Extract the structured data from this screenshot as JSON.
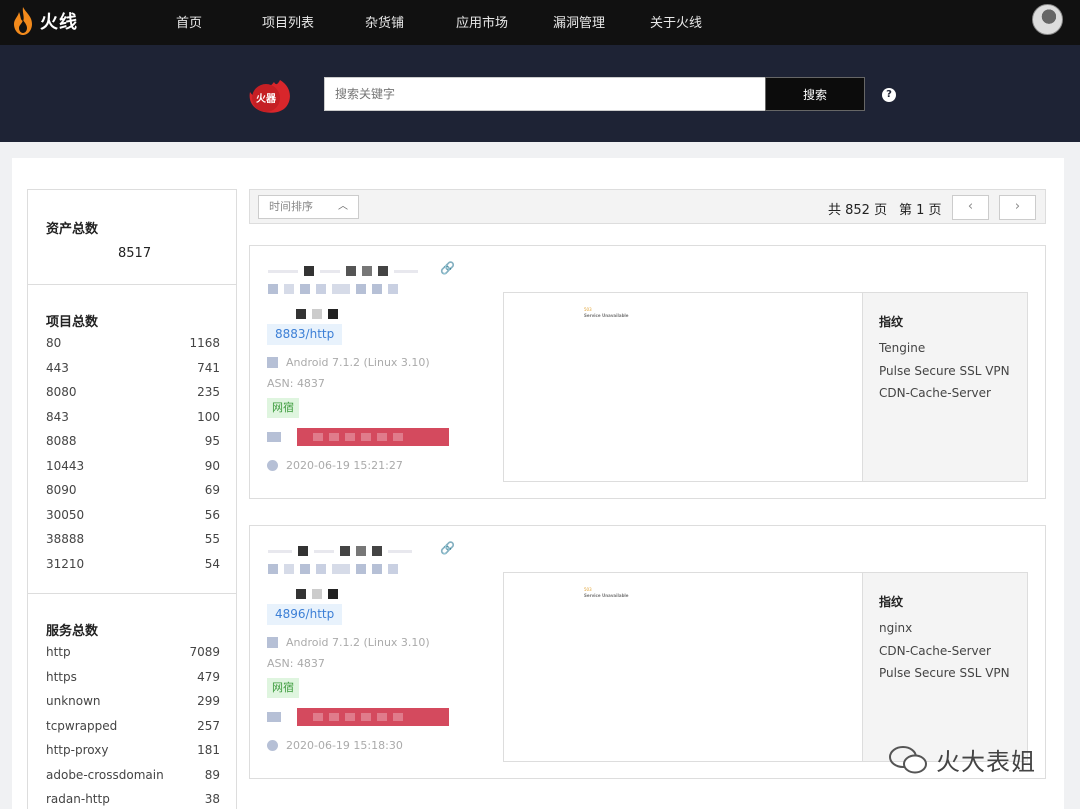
{
  "nav": {
    "brand": "火线",
    "items": [
      "首页",
      "项目列表",
      "杂货铺",
      "应用市场",
      "漏洞管理",
      "关于火线"
    ]
  },
  "search": {
    "logo_text": "火器",
    "placeholder": "搜索关键字",
    "button": "搜索",
    "help": "?"
  },
  "sidebar": {
    "assets": {
      "title": "资产总数",
      "total": "8517"
    },
    "projects": {
      "title": "项目总数",
      "rows": [
        {
          "k": "80",
          "v": "1168"
        },
        {
          "k": "443",
          "v": "741"
        },
        {
          "k": "8080",
          "v": "235"
        },
        {
          "k": "843",
          "v": "100"
        },
        {
          "k": "8088",
          "v": "95"
        },
        {
          "k": "10443",
          "v": "90"
        },
        {
          "k": "8090",
          "v": "69"
        },
        {
          "k": "30050",
          "v": "56"
        },
        {
          "k": "38888",
          "v": "55"
        },
        {
          "k": "31210",
          "v": "54"
        }
      ]
    },
    "services": {
      "title": "服务总数",
      "rows": [
        {
          "k": "http",
          "v": "7089"
        },
        {
          "k": "https",
          "v": "479"
        },
        {
          "k": "unknown",
          "v": "299"
        },
        {
          "k": "tcpwrapped",
          "v": "257"
        },
        {
          "k": "http-proxy",
          "v": "181"
        },
        {
          "k": "adobe-crossdomain",
          "v": "89"
        },
        {
          "k": "radan-http",
          "v": "38"
        }
      ]
    }
  },
  "toolbar": {
    "sort": "时间排序",
    "total_pages": "共 852 页",
    "current_page": "第 1 页",
    "prev": "‹",
    "next": "›"
  },
  "results": [
    {
      "port": "8883/http",
      "os": "Android 7.1.2 (Linux 3.10)",
      "asn": "ASN: 4837",
      "tag": "网宿",
      "time": "2020-06-19 15:21:27",
      "fingerprint_title": "指纹",
      "fingerprints": [
        "Tengine",
        "Pulse Secure SSL VPN",
        "CDN-Cache-Server"
      ],
      "preview_lines": [
        "503",
        "Service Unavailable"
      ]
    },
    {
      "port": "4896/http",
      "os": "Android 7.1.2 (Linux 3.10)",
      "asn": "ASN: 4837",
      "tag": "网宿",
      "time": "2020-06-19 15:18:30",
      "fingerprint_title": "指纹",
      "fingerprints": [
        "nginx",
        "CDN-Cache-Server",
        "Pulse Secure SSL VPN"
      ],
      "preview_lines": [
        "503",
        "Service Unavailable"
      ]
    }
  ],
  "watermark": "火大表姐",
  "colors": {
    "accent": "#3c7fd6",
    "redact": "#d44a5e",
    "nav_bg": "#111111",
    "band_bg": "#1e2335"
  }
}
